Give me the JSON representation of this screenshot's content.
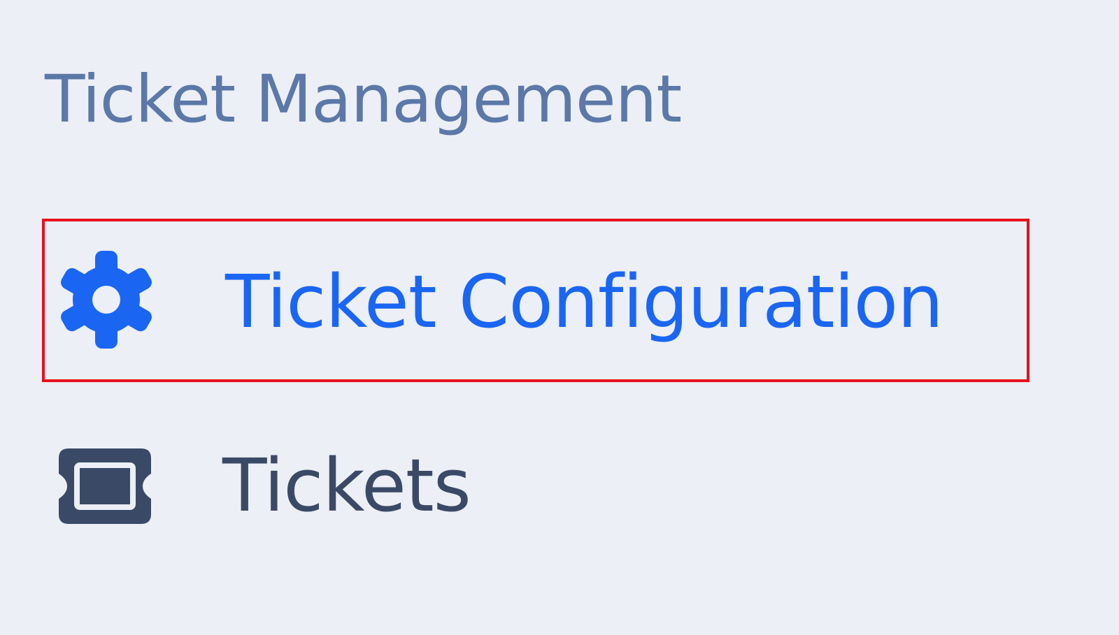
{
  "sidebar": {
    "section_title": "Ticket Management",
    "items": [
      {
        "label": "Ticket Configuration",
        "icon": "gear-icon",
        "selected": true
      },
      {
        "label": "Tickets",
        "icon": "ticket-icon",
        "selected": false
      }
    ]
  },
  "colors": {
    "background": "#ECEFF5",
    "section_title": "#5B78A8",
    "active": "#1A66F2",
    "inactive": "#3A4A66",
    "highlight_box": "#E8101C"
  }
}
